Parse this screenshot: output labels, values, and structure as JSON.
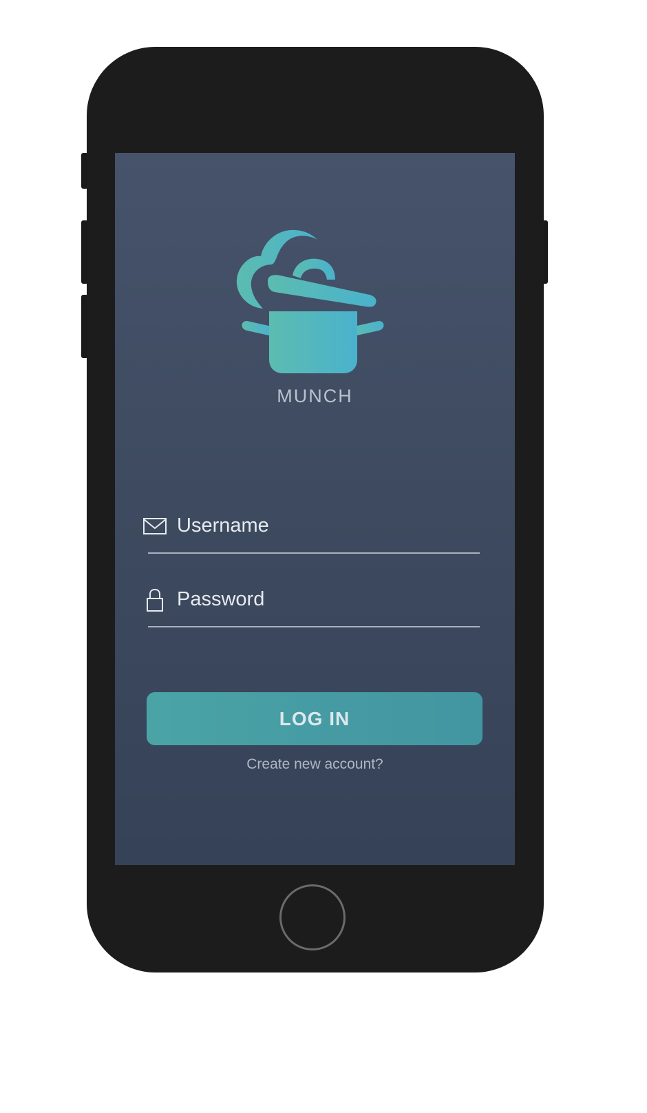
{
  "app": {
    "name": "MUNCH",
    "logo_icon": "cooking-pot-icon"
  },
  "form": {
    "username": {
      "icon": "envelope-icon",
      "placeholder": "Username",
      "value": ""
    },
    "password": {
      "icon": "lock-icon",
      "placeholder": "Password",
      "value": ""
    },
    "login_label": "LOG IN",
    "create_account_label": "Create new account?"
  },
  "colors": {
    "screen_bg": "#46536b",
    "accent_start": "#5cbcb0",
    "accent_end": "#4ab2cd",
    "button": "#4aa4a6",
    "phone_body": "#1c1c1c"
  }
}
